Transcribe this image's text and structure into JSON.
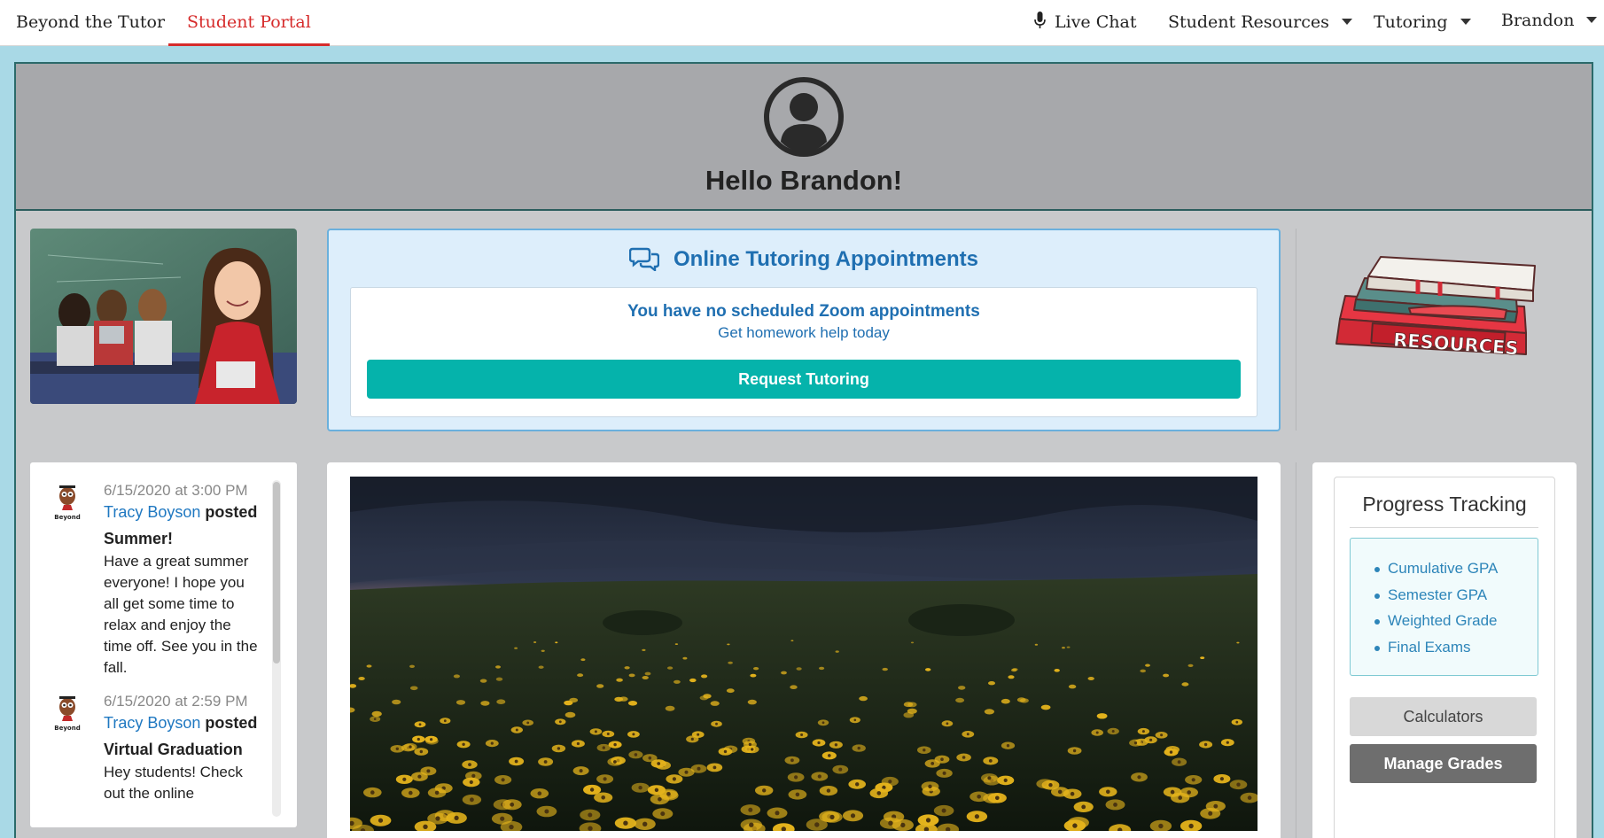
{
  "nav": {
    "brand": "Beyond the Tutor",
    "portal": "Student Portal",
    "live_chat": "Live Chat",
    "student_resources": "Student Resources",
    "tutoring": "Tutoring",
    "user": "Brandon"
  },
  "header": {
    "greeting": "Hello Brandon!"
  },
  "tutoring_card": {
    "title": "Online Tutoring Appointments",
    "no_appointments": "You have no scheduled Zoom appointments",
    "help_text": "Get homework help today",
    "button": "Request Tutoring"
  },
  "resources_label": "RESOURCES",
  "news": {
    "posts": [
      {
        "logo_text": "Beyond",
        "date": "6/15/2020 at 3:00 PM",
        "author": "Tracy Boyson",
        "verb": "posted",
        "title": "Summer!",
        "body": "Have a great summer everyone! I hope you all get some time to relax and enjoy the time off. See you in the fall."
      },
      {
        "logo_text": "Beyond",
        "date": "6/15/2020 at 2:59 PM",
        "author": "Tracy Boyson",
        "verb": "posted",
        "title": "Virtual Graduation",
        "body": "Hey students! Check out the online"
      }
    ]
  },
  "progress": {
    "title": "Progress Tracking",
    "items": [
      "Cumulative GPA",
      "Semester GPA",
      "Weighted Grade",
      "Final Exams"
    ],
    "calculators": "Calculators",
    "manage_grades": "Manage Grades"
  },
  "colors": {
    "accent_red": "#d62b2b",
    "teal_button": "#05b3ab",
    "link_blue": "#1f6fb1"
  }
}
